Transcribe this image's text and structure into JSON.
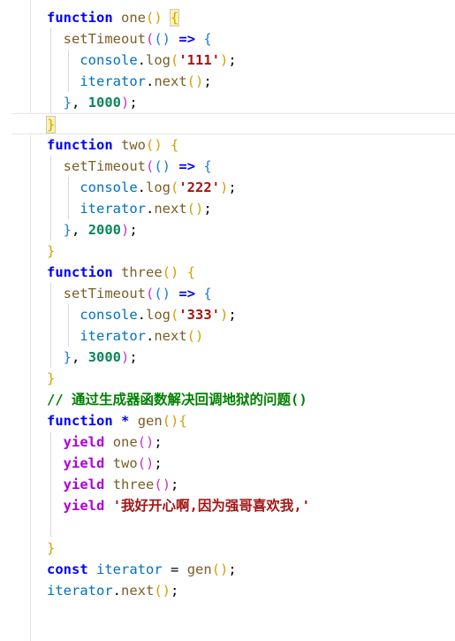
{
  "code": {
    "kw_function": "function",
    "kw_yield": "yield",
    "kw_const": "const",
    "setTimeout": "setTimeout",
    "console": "console",
    "log": "log",
    "iterator": "iterator",
    "next": "next",
    "arrow": "=>",
    "star": "*",
    "equals": "=",
    "fn_one": "one",
    "fn_two": "two",
    "fn_three": "three",
    "fn_gen": "gen",
    "str_111": "'111'",
    "str_222": "'222'",
    "str_333": "'333'",
    "str_final": "'我好开心啊,因为强哥喜欢我,'",
    "num_1000": "1000",
    "num_2000": "2000",
    "num_3000": "3000",
    "comment": "// 通过生成器函数解决回调地狱的问题()"
  }
}
